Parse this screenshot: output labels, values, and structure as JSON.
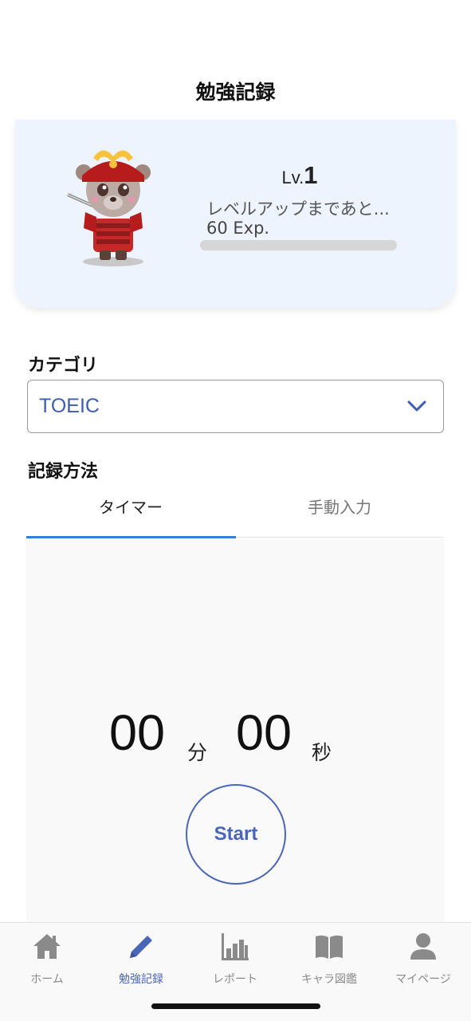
{
  "header": {
    "title": "勉強記録"
  },
  "character_card": {
    "level_prefix": "Lv.",
    "level_number": "1",
    "levelup_text": "レベルアップまであと...",
    "exp_text": "60 Exp.",
    "exp_progress_fraction": 0
  },
  "category": {
    "label": "カテゴリ",
    "selected": "TOEIC"
  },
  "record_method": {
    "label": "記録方法",
    "tabs": [
      "タイマー",
      "手動入力"
    ],
    "active_tab": 0
  },
  "timer": {
    "minutes": "00",
    "minutes_unit": "分",
    "seconds": "00",
    "seconds_unit": "秒",
    "start_label": "Start"
  },
  "bottom_nav": {
    "items": [
      {
        "label": "ホーム",
        "icon": "home-icon"
      },
      {
        "label": "勉強記録",
        "icon": "pencil-icon"
      },
      {
        "label": "レポート",
        "icon": "bar-chart-icon"
      },
      {
        "label": "キャラ図鑑",
        "icon": "book-icon"
      },
      {
        "label": "マイページ",
        "icon": "person-icon"
      }
    ],
    "active_index": 1
  },
  "colors": {
    "accent": "#4a66b8",
    "tab_indicator": "#3a7be0",
    "card_bg": "#eef4fd"
  }
}
